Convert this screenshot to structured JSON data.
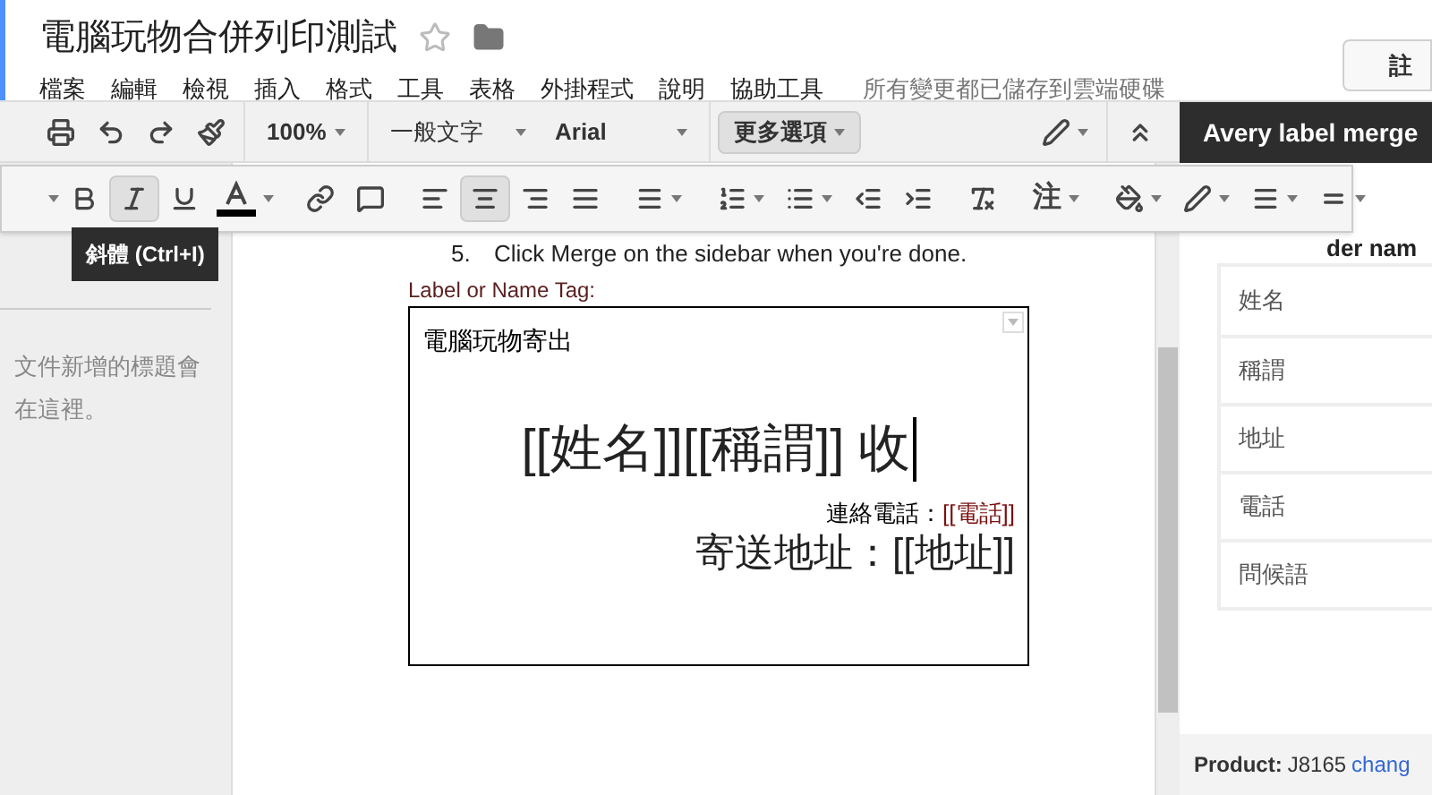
{
  "document": {
    "title": "電腦玩物合併列印測試",
    "starred": false
  },
  "menu": [
    "檔案",
    "編輯",
    "檢視",
    "插入",
    "格式",
    "工具",
    "表格",
    "外掛程式",
    "說明",
    "協助工具"
  ],
  "save_status": "所有變更都已儲存到雲端硬碟",
  "share_button": "註",
  "toolbar": {
    "zoom": "100%",
    "style": "一般文字",
    "font": "Arial",
    "more": {
      "label": "更多選項",
      "selected": true
    }
  },
  "format_toolbar": {
    "text_styles": [
      {
        "kind": "bold",
        "selected": false
      },
      {
        "kind": "italic",
        "selected": true
      },
      {
        "kind": "underline",
        "selected": false
      }
    ],
    "align_buttons": [
      {
        "kind": "left",
        "selected": false
      },
      {
        "kind": "center",
        "selected": true
      },
      {
        "kind": "right",
        "selected": false
      },
      {
        "kind": "justify",
        "selected": false
      }
    ],
    "note_button": "注"
  },
  "tooltip": "斜體 (Ctrl+I)",
  "outline_hint": [
    "文件新增的標題會",
    "在這裡。"
  ],
  "body": {
    "list_item": {
      "number": "5.",
      "text": "Click Merge on the sidebar when you're done."
    },
    "label_heading": "Label or Name Tag:",
    "label": {
      "sender": "電腦玩物寄出",
      "recipient": "[[姓名]][[稱謂]] 收",
      "phone_label": "連絡電話：",
      "phone_field": "[[電話]]",
      "address": "寄送地址：[[地址]]"
    }
  },
  "sidebar": {
    "title": "Avery label merge",
    "header_partial": "der nam",
    "fields": [
      "姓名",
      "稱謂",
      "地址",
      "電話",
      "問候語"
    ],
    "product_label": "Product:",
    "product_code": "J8165",
    "change_link": "chang"
  }
}
